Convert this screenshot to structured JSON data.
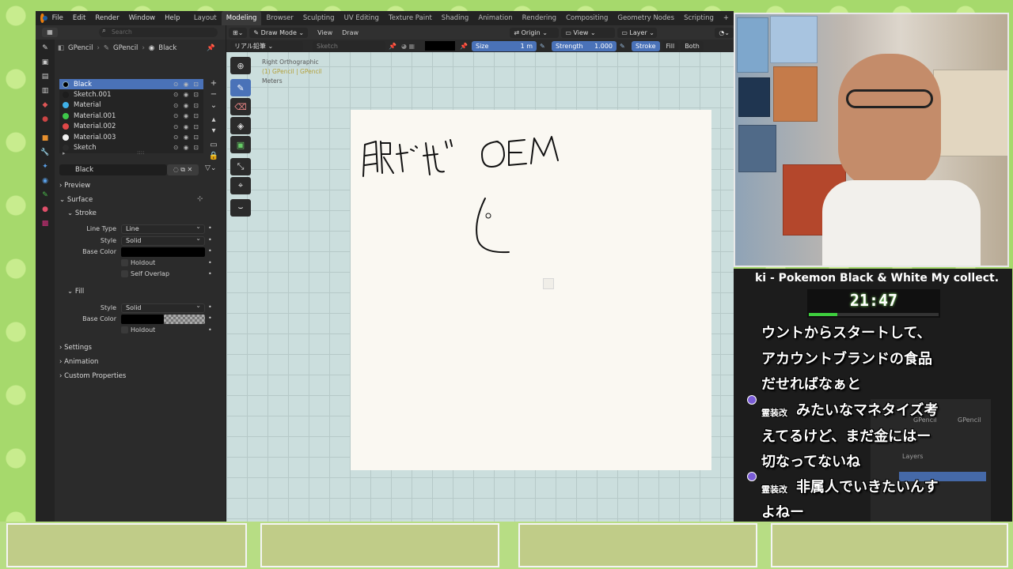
{
  "menu": {
    "file": "File",
    "edit": "Edit",
    "render": "Render",
    "window": "Window",
    "help": "Help"
  },
  "workspaces": [
    "Layout",
    "Modeling",
    "Browser",
    "Sculpting",
    "UV Editing",
    "Texture Paint",
    "Shading",
    "Animation",
    "Rendering",
    "Compositing",
    "Geometry Nodes",
    "Scripting"
  ],
  "active_workspace": "Modeling",
  "add_workspace": "+",
  "props": {
    "search_placeholder": "Search",
    "breadcrumb": [
      "GPencil",
      "GPencil",
      "Black"
    ],
    "materials": [
      {
        "name": "Black",
        "color": "#000000",
        "selected": true
      },
      {
        "name": "Sketch.001",
        "color": "#1d1d1d",
        "selected": false
      },
      {
        "name": "Material",
        "color": "#3fb0e8",
        "selected": false
      },
      {
        "name": "Material.001",
        "color": "#3ec84a",
        "selected": false
      },
      {
        "name": "Material.002",
        "color": "#e04848",
        "selected": false
      },
      {
        "name": "Material.003",
        "color": "#f0f0f0",
        "selected": false
      },
      {
        "name": "Sketch",
        "color": "#2b2b2b",
        "selected": false
      }
    ],
    "slot_name": "Black",
    "sections": {
      "preview": "Preview",
      "surface": "Surface",
      "stroke": "Stroke",
      "fill": "Fill",
      "settings": "Settings",
      "animation": "Animation",
      "custom_properties": "Custom Properties"
    },
    "stroke": {
      "line_type_label": "Line Type",
      "line_type": "Line",
      "style_label": "Style",
      "style": "Solid",
      "base_color_label": "Base Color",
      "holdout_label": "Holdout",
      "self_overlap_label": "Self Overlap"
    },
    "fill": {
      "style_label": "Style",
      "style": "Solid",
      "base_color_label": "Base Color",
      "holdout_label": "Holdout"
    }
  },
  "viewport": {
    "mode": "Draw Mode",
    "view_menu": "View",
    "draw_menu": "Draw",
    "origin": "Origin",
    "view": "View",
    "layer": "Layer",
    "brush": "リアル鉛筆",
    "material_field": "Sketch",
    "size_label": "Size",
    "size_value": "1 m",
    "strength_label": "Strength",
    "strength_value": "1.000",
    "stroke_btn": "Stroke",
    "fill_btn": "Fill",
    "both_btn": "Both",
    "overlay_view": "Right Orthographic",
    "overlay_object": "(1) GPencil | GPencil",
    "overlay_units": "Meters"
  },
  "stream": {
    "marquee": "ki - Pokemon Black & White My collect.",
    "timer": "21:47",
    "timer_progress": 0.22,
    "chat": [
      "ウントからスタートして、",
      "アカウントブランドの食品",
      "だせればなぁと",
      "みたいなマネタイズ考",
      "えてるけど、まだ金にはー",
      "切なってないね",
      "非属人でいきたいんす",
      "よねー"
    ],
    "chat_user": "霊装改",
    "mini_blender": {
      "crumb": "GPencil",
      "label": "Layers"
    }
  },
  "colors": {
    "accent": "#4a72b8",
    "canvas": "#faf8f2",
    "viewport_bg": "#cbdedd",
    "timer_green": "#3ecf3e"
  }
}
